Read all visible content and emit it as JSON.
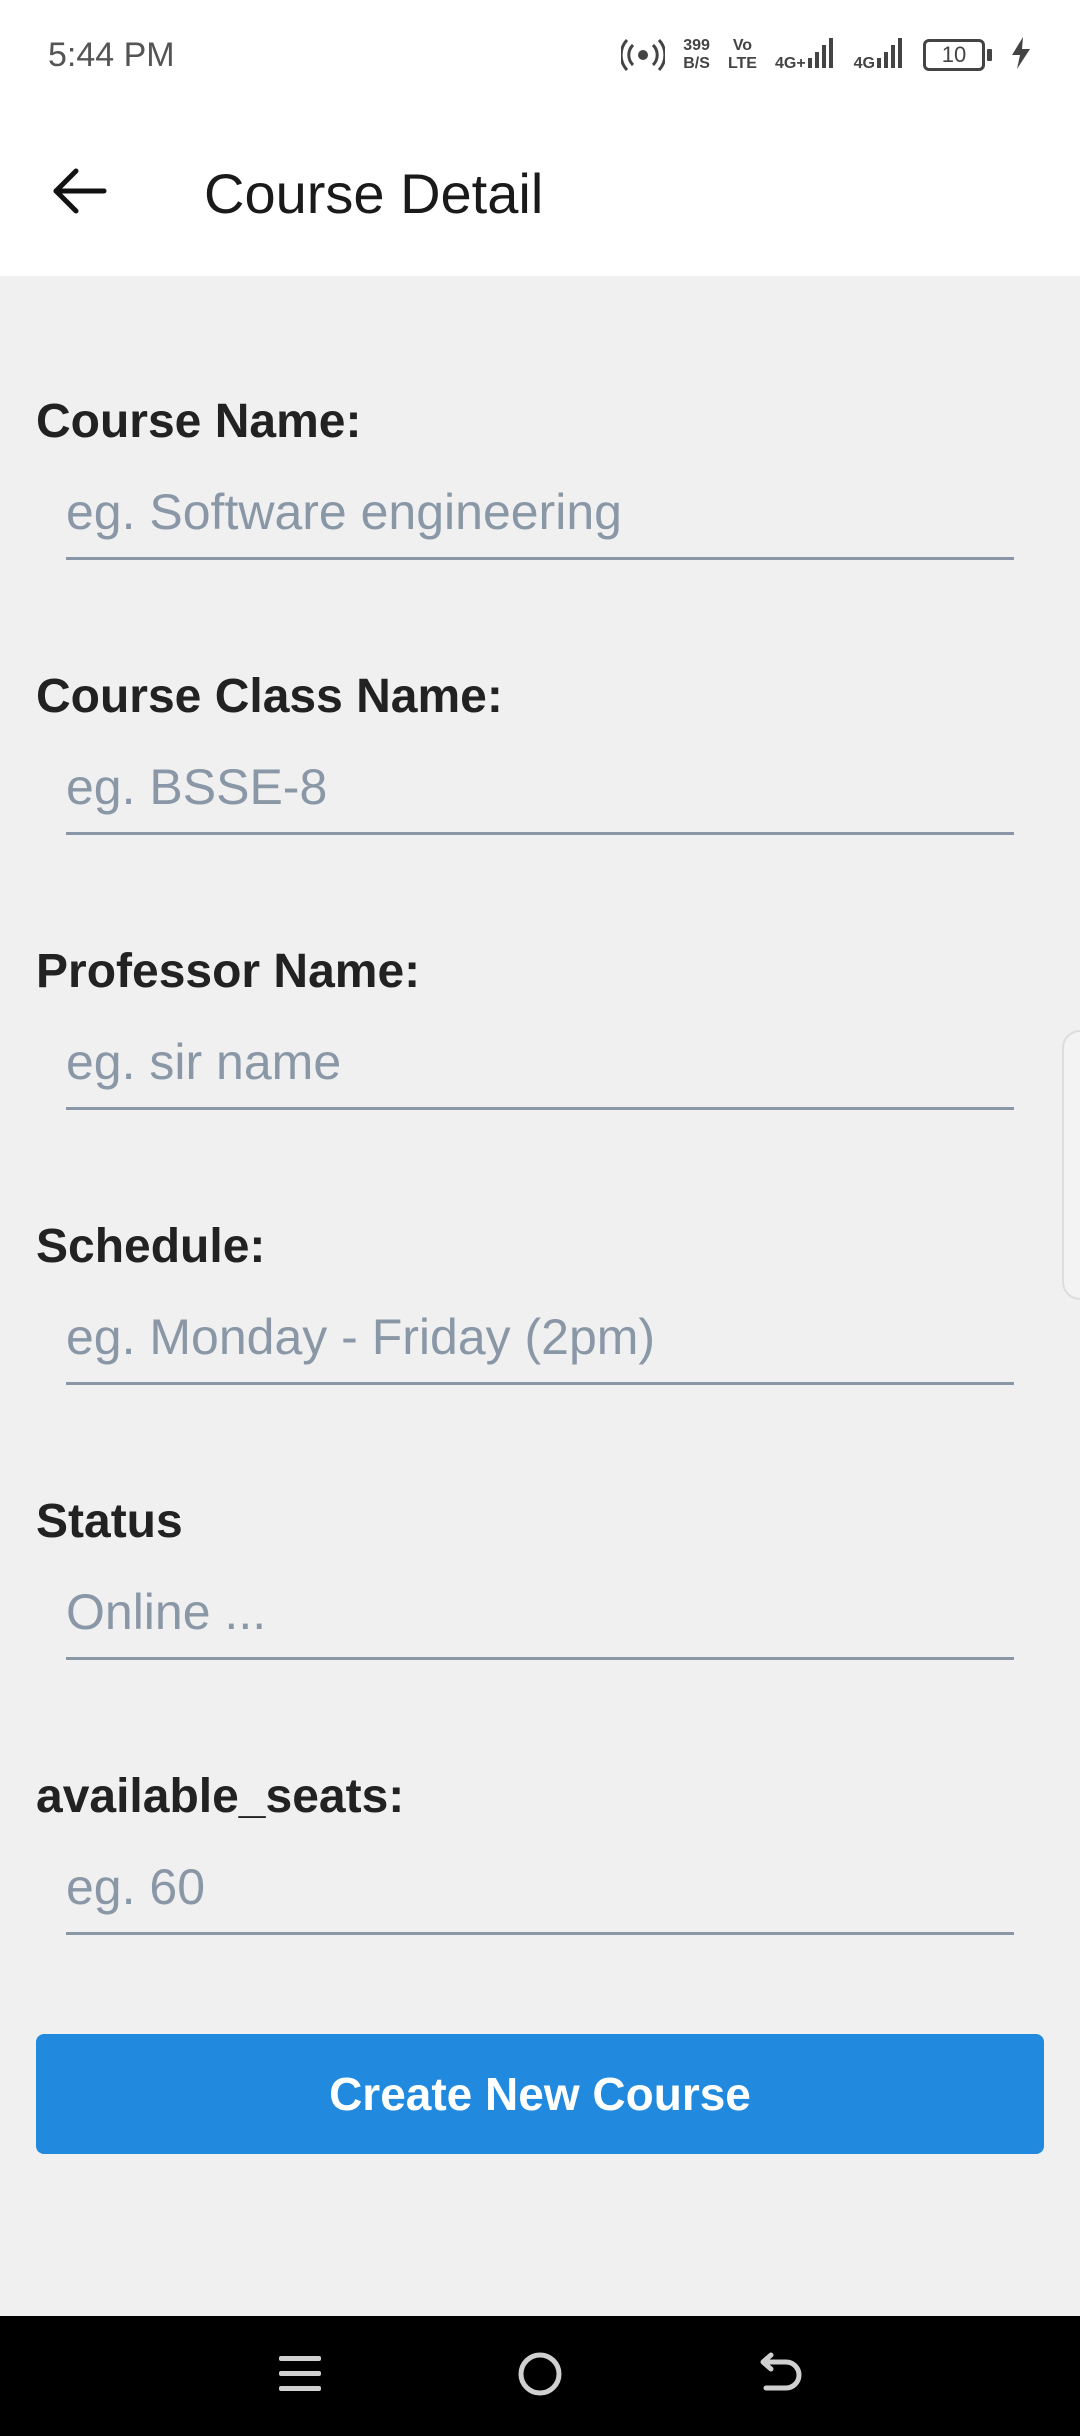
{
  "status_bar": {
    "time": "5:44 PM",
    "data_speed_value": "399",
    "data_speed_unit": "B/S",
    "volte_top": "Vo",
    "volte_bottom": "LTE",
    "network1": "4G+",
    "network2": "4G",
    "battery_level": "10"
  },
  "app_bar": {
    "title": "Course Detail"
  },
  "form": {
    "fields": [
      {
        "label": "Course Name:",
        "placeholder": "eg. Software engineering",
        "value": ""
      },
      {
        "label": "Course Class Name:",
        "placeholder": "eg. BSSE-8",
        "value": ""
      },
      {
        "label": "Professor Name:",
        "placeholder": "eg. sir name",
        "value": ""
      },
      {
        "label": "Schedule:",
        "placeholder": "eg. Monday - Friday (2pm)",
        "value": ""
      },
      {
        "label": "Status",
        "placeholder": "Online ...",
        "value": ""
      },
      {
        "label": "available_seats:",
        "placeholder": "eg. 60",
        "value": ""
      }
    ],
    "submit_label": "Create New Course"
  },
  "colors": {
    "primary_button": "#2189de",
    "background": "#f0f0f0",
    "input_underline": "#8a97a6"
  },
  "icons": {
    "back": "arrow-left-icon",
    "hotspot": "hotspot-icon",
    "signal": "signal-icon",
    "battery": "battery-icon",
    "charging": "lightning-icon",
    "nav_menu": "menu-icon",
    "nav_home": "home-circle-icon",
    "nav_back": "back-curve-icon"
  }
}
